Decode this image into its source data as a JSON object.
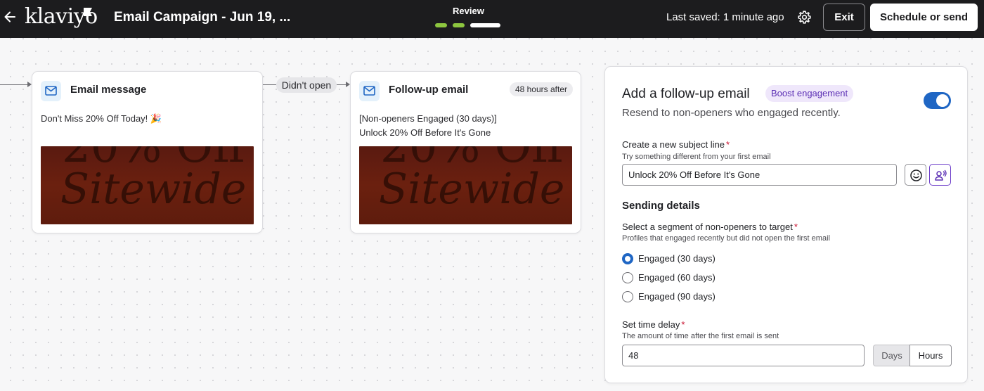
{
  "topbar": {
    "logo": "klaviyo",
    "campaign_title": "Email Campaign - Jun 19, ...",
    "review_label": "Review",
    "last_saved": "Last saved: 1 minute ago",
    "exit_label": "Exit",
    "schedule_label": "Schedule or send",
    "progress_steps": [
      {
        "state": "complete",
        "color": "#8dc63f"
      },
      {
        "state": "complete",
        "color": "#8dc63f"
      },
      {
        "state": "current",
        "color": "#ffffff"
      }
    ]
  },
  "flow": {
    "connector_label": "Didn't open",
    "nodes": [
      {
        "title": "Email message",
        "subject": "Don't Miss 20% Off Today! 🎉",
        "badge": null,
        "preview_text_1": "20% Off",
        "preview_text_2": "Sitewide"
      },
      {
        "title": "Follow-up email",
        "subject_line1": "[Non-openers Engaged (30 days)]",
        "subject_line2": "Unlock 20% Off Before It's Gone",
        "badge": "48 hours after",
        "preview_text_1": "20% Off",
        "preview_text_2": "Sitewide"
      }
    ]
  },
  "panel": {
    "title": "Add a follow-up email",
    "badge": "Boost engagement",
    "subtitle": "Resend to non-openers who engaged recently.",
    "toggle_on": true,
    "subject_label": "Create a new subject line",
    "subject_hint": "Try something different from your first email",
    "subject_value": "Unlock 20% Off Before It's Gone",
    "sending_details_title": "Sending details",
    "segment_label": "Select a segment of non-openers to target",
    "segment_hint": "Profiles that engaged recently but did not open the first email",
    "segment_options": [
      {
        "label": "Engaged (30 days)",
        "checked": true
      },
      {
        "label": "Engaged (60 days)",
        "checked": false
      },
      {
        "label": "Engaged (90 days)",
        "checked": false
      }
    ],
    "delay_label": "Set time delay",
    "delay_hint": "The amount of time after the first email is sent",
    "delay_value": "48",
    "unit_options": [
      "Days",
      "Hours"
    ],
    "selected_unit": "Hours"
  },
  "colors": {
    "topbar_bg": "#1c1c1e",
    "accent_blue": "#1f66c4",
    "progress_green": "#8dc63f",
    "boost_purple": "#5b2fb4",
    "required_red": "#c8102e"
  },
  "icons": [
    "back-arrow-icon",
    "klaviyo-flag-icon",
    "settings-gear-icon",
    "email-icon",
    "emoji-icon",
    "ai-personalize-icon"
  ]
}
